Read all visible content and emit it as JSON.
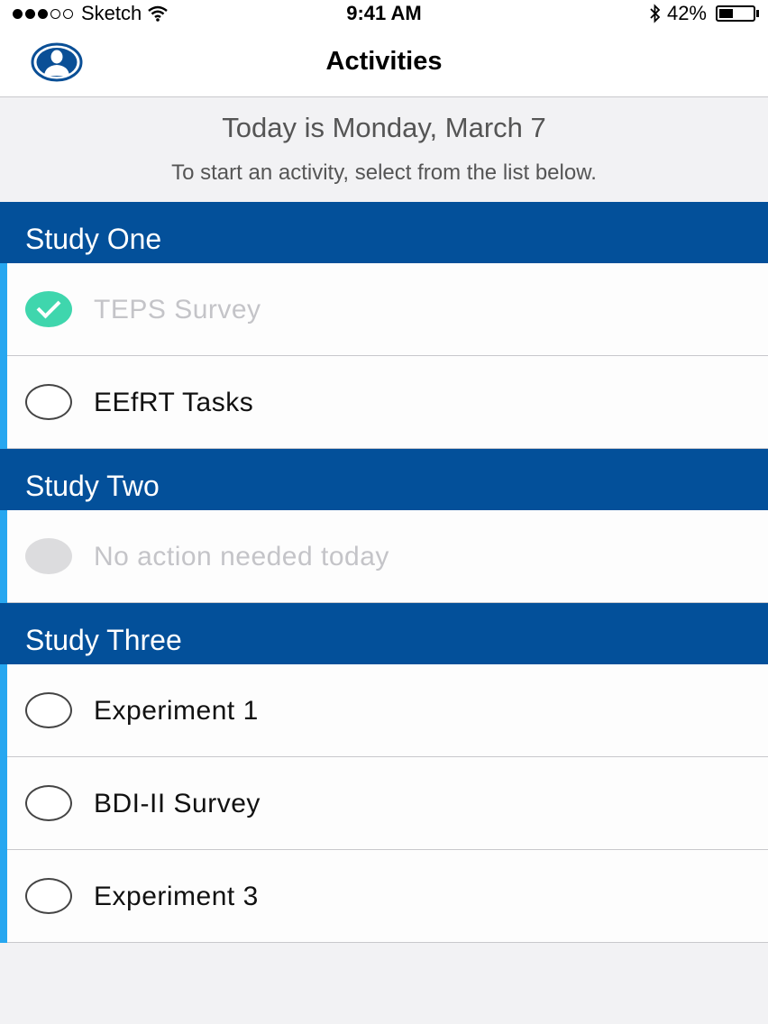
{
  "status_bar": {
    "carrier": "Sketch",
    "time": "9:41 AM",
    "battery_percent": "42%",
    "battery_level": 0.42,
    "signal_bars_filled": 3,
    "signal_bars_total": 5
  },
  "nav": {
    "title": "Activities",
    "profile_icon": "person-icon"
  },
  "info": {
    "today": "Today is Monday, March 7",
    "hint": "To start an activity, select from the list below."
  },
  "colors": {
    "section_header": "#03509a",
    "accent_bar": "#27a7f0",
    "complete": "#3fd6ad"
  },
  "sections": [
    {
      "title": "Study One",
      "items": [
        {
          "label": "TEPS Survey",
          "state": "complete"
        },
        {
          "label": "EEfRT Tasks",
          "state": "pending"
        }
      ]
    },
    {
      "title": "Study Two",
      "items": [
        {
          "label": "No action needed today",
          "state": "disabled"
        }
      ]
    },
    {
      "title": "Study Three",
      "items": [
        {
          "label": "Experiment 1",
          "state": "pending"
        },
        {
          "label": "BDI-II Survey",
          "state": "pending"
        },
        {
          "label": "Experiment 3",
          "state": "pending"
        }
      ]
    }
  ]
}
